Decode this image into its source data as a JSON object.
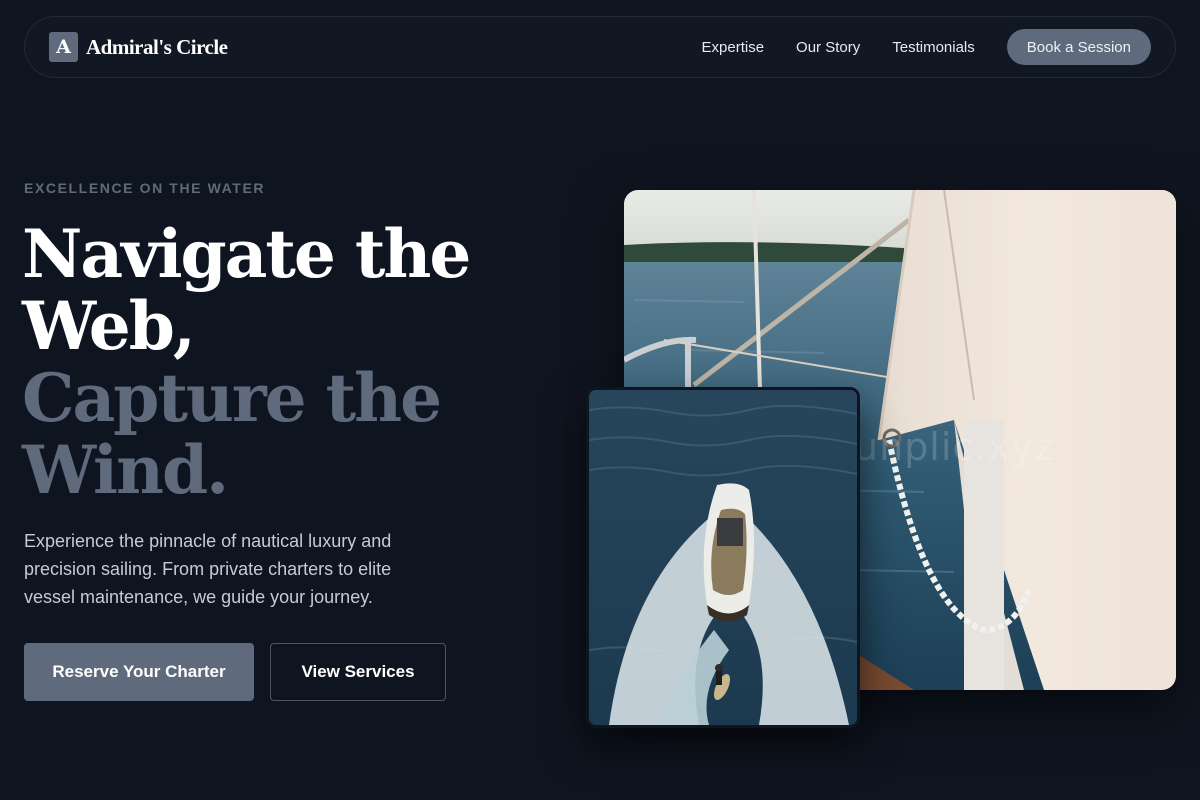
{
  "nav": {
    "brand_letter": "A",
    "brand_name": "Admiral's Circle",
    "links": [
      "Expertise",
      "Our Story",
      "Testimonials"
    ],
    "cta_label": "Book a Session"
  },
  "hero": {
    "eyebrow": "EXCELLENCE ON THE WATER",
    "headline_line1": "Navigate the",
    "headline_line2": "Web,",
    "headline_line3": "Capture the",
    "headline_line4": "Wind.",
    "subcopy": "Experience the pinnacle of nautical luxury and precision sailing. From private charters to elite vessel maintenance, we guide your journey.",
    "primary_button": "Reserve Your Charter",
    "secondary_button": "View Services"
  },
  "images": {
    "main_watermark": "unplic.xyz"
  },
  "colors": {
    "background": "#0f1520",
    "accent": "#5f6b7c",
    "text": "#ffffff",
    "muted_text": "#c4cbd5"
  }
}
